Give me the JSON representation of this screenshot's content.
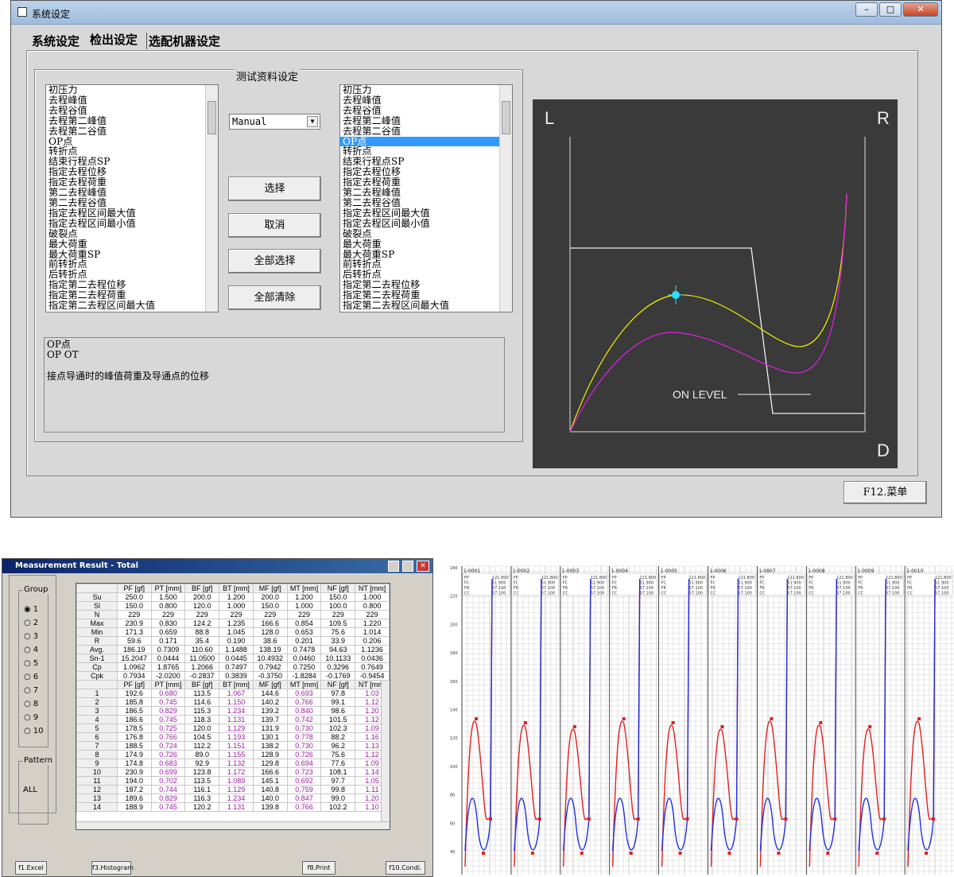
{
  "win1": {
    "title": "系统设定",
    "tabs": [
      "系统设定",
      "检出设定",
      "选配机器设定"
    ],
    "frame_title": "测试资料设定",
    "left_list": [
      "初压力",
      "去程峰值",
      "去程谷值",
      "去程第二峰值",
      "去程第二谷值",
      "OP点",
      "转折点",
      "结束行程点SP",
      "指定去程位移",
      "指定去程荷重",
      "第二去程峰值",
      "第二去程谷值",
      "指定去程区间最大值",
      "指定去程区间最小值",
      "破裂点",
      "最大荷重",
      "最大荷重SP",
      "前转折点",
      "后转折点",
      "指定第二去程位移",
      "指定第二去程荷重",
      "指定第二去程区间最大值"
    ],
    "right_list": [
      "初压力",
      "去程峰值",
      "去程谷值",
      "去程第二峰值",
      "去程第二谷值",
      "OP点",
      "转折点",
      "结束行程点SP",
      "指定去程位移",
      "指定去程荷重",
      "第二去程峰值",
      "第二去程谷值",
      "指定去程区间最大值",
      "指定去程区间最小值",
      "破裂点",
      "最大荷重",
      "最大荷重SP",
      "前转折点",
      "后转折点",
      "指定第二去程位移",
      "指定第二去程荷重",
      "指定第二去程区间最大值"
    ],
    "right_selected": "OP点",
    "dropdown": "Manual",
    "buttons": [
      "选择",
      "取消",
      "全部选择",
      "全部清除"
    ],
    "desc": [
      "OP点",
      "OP OT",
      "接点导通时的峰值荷重及导通点的位移"
    ],
    "plot": {
      "L": "L",
      "R": "R",
      "D": "D",
      "on_level": "ON LEVEL"
    },
    "menu_button": "F12.菜单"
  },
  "win2": {
    "title": "Measurement Result - Total",
    "group_label": "Group",
    "groups": [
      "1",
      "2",
      "3",
      "4",
      "5",
      "6",
      "7",
      "8",
      "9",
      "10"
    ],
    "pattern_label": "Pattern",
    "pattern_value": "ALL",
    "headers": [
      "",
      "PF [gf]",
      "PT [mm]",
      "BF [gf]",
      "BT [mm]",
      "MF [gf]",
      "MT [mm]",
      "NF [gf]",
      "NT [mm]"
    ],
    "stats": [
      [
        "Su",
        "250.0",
        "1.500",
        "200.0",
        "1.200",
        "200.0",
        "1.200",
        "150.0",
        "1.000"
      ],
      [
        "Sl",
        "150.0",
        "0.800",
        "120.0",
        "1.000",
        "150.0",
        "1.000",
        "100.0",
        "0.800"
      ],
      [
        "N",
        "229",
        "229",
        "229",
        "229",
        "229",
        "229",
        "229",
        "229"
      ],
      [
        "Max",
        "230.9",
        "0.830",
        "124.2",
        "1.235",
        "166.6",
        "0.854",
        "109.5",
        "1.220"
      ],
      [
        "Min",
        "171.3",
        "0.659",
        "88.8",
        "1.045",
        "128.0",
        "0.653",
        "75.6",
        "1.014"
      ],
      [
        "R",
        "59.6",
        "0.171",
        "35.4",
        "0.190",
        "38.6",
        "0.201",
        "33.9",
        "0.206"
      ],
      [
        "Avg.",
        "186.19",
        "0.7309",
        "110.60",
        "1.1488",
        "138.19",
        "0.7478",
        "94.63",
        "1.1236"
      ],
      [
        "Sn-1",
        "15.2047",
        "0.0444",
        "11.0500",
        "0.0445",
        "10.4932",
        "0.0460",
        "10.1133",
        "0.0436"
      ],
      [
        "Cp",
        "1.0962",
        "1.8765",
        "1.2066",
        "0.7497",
        "0.7942",
        "0.7250",
        "0.3296",
        "0.7649"
      ],
      [
        "Cpk",
        "0.7934",
        "-2.0200",
        "-0.2837",
        "0.3839",
        "-0.3750",
        "-1.8284",
        "-0.1769",
        "-0.9454"
      ]
    ],
    "rows": [
      [
        "1",
        "192.6",
        "0.680",
        "113.5",
        "1.067",
        "144.6",
        "0.693",
        "97.8",
        "1.03"
      ],
      [
        "2",
        "185.8",
        "0.745",
        "114.6",
        "1.150",
        "140.2",
        "0.766",
        "99.1",
        "1.12"
      ],
      [
        "3",
        "186.5",
        "0.829",
        "115.3",
        "1.234",
        "139.2",
        "0.840",
        "98.6",
        "1.20"
      ],
      [
        "4",
        "186.6",
        "0.745",
        "118.3",
        "1.131",
        "139.7",
        "0.742",
        "101.5",
        "1.12"
      ],
      [
        "5",
        "178.5",
        "0.725",
        "120.0",
        "1.129",
        "131.9",
        "0.730",
        "102.3",
        "1.09"
      ],
      [
        "6",
        "176.8",
        "0.766",
        "104.5",
        "1.193",
        "130.1",
        "0.778",
        "88.2",
        "1.16"
      ],
      [
        "7",
        "188.5",
        "0.724",
        "112.2",
        "1.151",
        "138.2",
        "0.730",
        "96.2",
        "1.13"
      ],
      [
        "8",
        "174.9",
        "0.726",
        "89.0",
        "1.155",
        "128.9",
        "0.726",
        "75.6",
        "1.12"
      ],
      [
        "9",
        "174.8",
        "0.683",
        "92.9",
        "1.132",
        "129.8",
        "0.694",
        "77.6",
        "1.09"
      ],
      [
        "10",
        "230.9",
        "0.699",
        "123.8",
        "1.172",
        "166.6",
        "0.723",
        "108.1",
        "1.14"
      ],
      [
        "11",
        "194.0",
        "0.702",
        "113.5",
        "1.089",
        "145.1",
        "0.692",
        "97.7",
        "1.05"
      ],
      [
        "12",
        "187.2",
        "0.744",
        "116.1",
        "1.129",
        "140.8",
        "0.759",
        "99.8",
        "1.11"
      ],
      [
        "13",
        "189.6",
        "0.829",
        "116.3",
        "1.234",
        "140.0",
        "0.847",
        "99.0",
        "1.20"
      ],
      [
        "14",
        "188.9",
        "0.745",
        "120.2",
        "1.131",
        "139.8",
        "0.766",
        "102.2",
        "1.10"
      ]
    ],
    "footer": [
      "f1.Excel",
      "f3.Histogram",
      "f8.Print",
      "f10.Condi."
    ]
  },
  "chart3": {
    "channels": [
      "1-0001",
      "1-0002",
      "1-0003",
      "1-0004",
      "1-0005",
      "1-0006",
      "1-0007",
      "1-0008",
      "1-0009",
      "1-0010"
    ],
    "top_rows": [
      [
        "FP",
        "121.800"
      ],
      [
        "FC",
        "51.900"
      ],
      [
        "FR",
        "57.100"
      ],
      [
        "CC",
        "57.100"
      ]
    ],
    "y_ticks": [
      "240",
      "220",
      "200",
      "180",
      "160",
      "140",
      "120",
      "100",
      "80",
      "60",
      "40"
    ]
  }
}
